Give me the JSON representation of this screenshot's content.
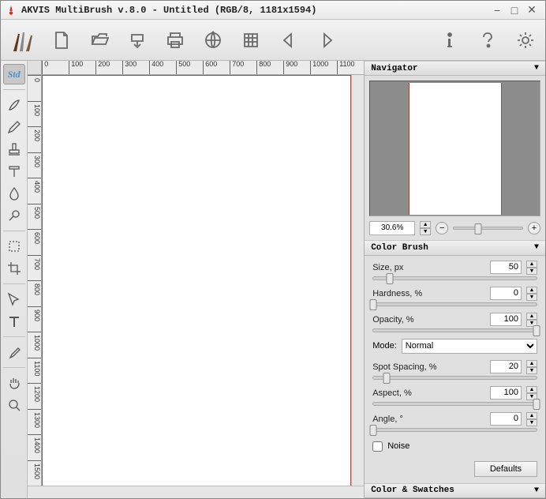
{
  "window": {
    "title": "AKVIS MultiBrush v.8.0 - Untitled (RGB/8, 1181x1594)",
    "min_icon": "−",
    "max_icon": "□",
    "close_icon": "✕"
  },
  "toolbar": {
    "new": "new-file",
    "open": "open",
    "save": "save",
    "print": "print",
    "share": "publish",
    "grid": "grid",
    "prev": "back",
    "next": "forward",
    "info": "i",
    "help": "?",
    "settings": "gear"
  },
  "left_tools": {
    "std_label": "Std"
  },
  "canvas": {
    "doc_w": 1181,
    "doc_h": 1594,
    "ruler_h": [
      "0",
      "100",
      "200",
      "300",
      "400",
      "500",
      "600",
      "700",
      "800",
      "900",
      "1000",
      "1100"
    ],
    "ruler_v": [
      "0",
      "100",
      "200",
      "300",
      "400",
      "500",
      "600",
      "700",
      "800",
      "900",
      "1000",
      "1100",
      "1200",
      "1300",
      "1400",
      "1500"
    ]
  },
  "navigator": {
    "title": "Navigator",
    "zoom_value": "30.6%",
    "slider_pct": 35
  },
  "brush": {
    "title": "Color Brush",
    "size_label": "Size, px",
    "size_value": "50",
    "size_pct": 10,
    "hardness_label": "Hardness, %",
    "hardness_value": "0",
    "hardness_pct": 0,
    "opacity_label": "Opacity, %",
    "opacity_value": "100",
    "opacity_pct": 100,
    "mode_label": "Mode:",
    "mode_value": "Normal",
    "spot_label": "Spot Spacing, %",
    "spot_value": "20",
    "spot_pct": 8,
    "aspect_label": "Aspect, %",
    "aspect_value": "100",
    "aspect_pct": 100,
    "angle_label": "Angle, °",
    "angle_value": "0",
    "angle_pct": 0,
    "noise_label": "Noise",
    "defaults_label": "Defaults"
  },
  "swatches": {
    "title": "Color & Swatches"
  }
}
